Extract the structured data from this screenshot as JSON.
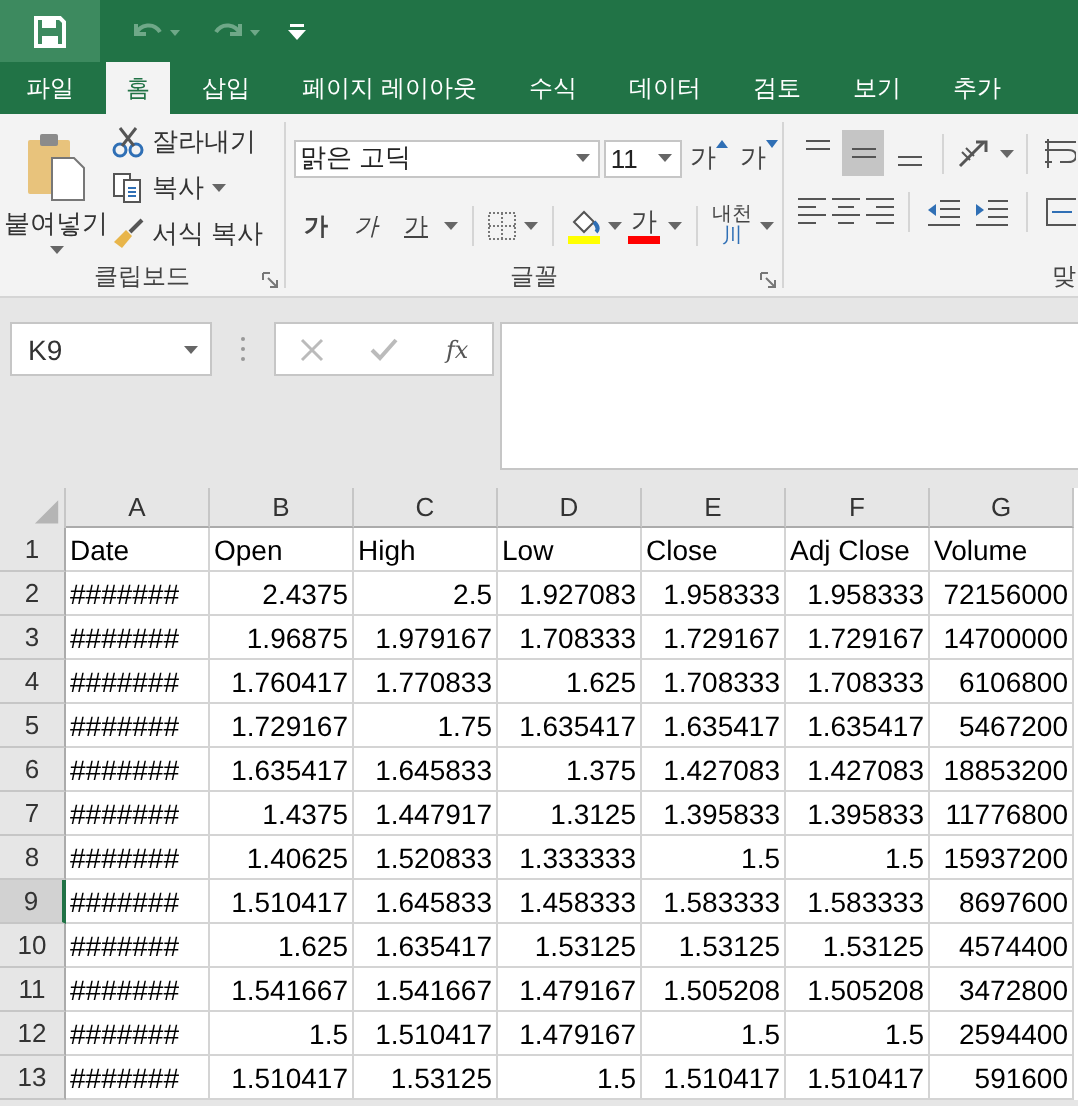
{
  "tabs": [
    {
      "label": "파일",
      "selected": false
    },
    {
      "label": "홈",
      "selected": true
    },
    {
      "label": "삽입",
      "selected": false
    },
    {
      "label": "페이지 레이아웃",
      "selected": false
    },
    {
      "label": "수식",
      "selected": false
    },
    {
      "label": "데이터",
      "selected": false
    },
    {
      "label": "검토",
      "selected": false
    },
    {
      "label": "보기",
      "selected": false
    },
    {
      "label": "추가",
      "selected": false
    }
  ],
  "ribbon": {
    "clipboard": {
      "label": "클립보드",
      "paste": "붙여넣기",
      "cut": "잘라내기",
      "copy": "복사",
      "format_painter": "서식 복사"
    },
    "font": {
      "label": "글꼴",
      "font_name": "맑은 고딕",
      "font_size": "11",
      "grow": "가",
      "shrink": "가",
      "bold": "가",
      "italic": "가",
      "underline": "가",
      "font_color": "가",
      "phonetic": "내천",
      "phonetic_glyph": "川"
    },
    "alignment": {
      "label": "맞",
      "vertical": [
        {
          "kind": "top",
          "selected": false
        },
        {
          "kind": "middle",
          "selected": true
        },
        {
          "kind": "bottom",
          "selected": false
        }
      ],
      "horizontal": [
        {
          "kind": "left",
          "selected": false
        },
        {
          "kind": "center",
          "selected": false
        },
        {
          "kind": "right",
          "selected": false
        }
      ]
    }
  },
  "formula_bar": {
    "name_box": "K9",
    "function": "fx"
  },
  "sheet": {
    "columns": [
      {
        "label": "A"
      },
      {
        "label": "B"
      },
      {
        "label": "C"
      },
      {
        "label": "D"
      },
      {
        "label": "E"
      },
      {
        "label": "F"
      },
      {
        "label": "G"
      }
    ],
    "rows": [
      {
        "header": "1",
        "kind": "labels",
        "selected": false,
        "cells": [
          "Date",
          "Open",
          "High",
          "Low",
          "Close",
          "Adj Close",
          "Volume"
        ]
      },
      {
        "header": "2",
        "kind": "values",
        "selected": false,
        "cells": [
          "#######",
          "2.4375",
          "2.5",
          "1.927083",
          "1.958333",
          "1.958333",
          "72156000"
        ]
      },
      {
        "header": "3",
        "kind": "values",
        "selected": false,
        "cells": [
          "#######",
          "1.96875",
          "1.979167",
          "1.708333",
          "1.729167",
          "1.729167",
          "14700000"
        ]
      },
      {
        "header": "4",
        "kind": "values",
        "selected": false,
        "cells": [
          "#######",
          "1.760417",
          "1.770833",
          "1.625",
          "1.708333",
          "1.708333",
          "6106800"
        ]
      },
      {
        "header": "5",
        "kind": "values",
        "selected": false,
        "cells": [
          "#######",
          "1.729167",
          "1.75",
          "1.635417",
          "1.635417",
          "1.635417",
          "5467200"
        ]
      },
      {
        "header": "6",
        "kind": "values",
        "selected": false,
        "cells": [
          "#######",
          "1.635417",
          "1.645833",
          "1.375",
          "1.427083",
          "1.427083",
          "18853200"
        ]
      },
      {
        "header": "7",
        "kind": "values",
        "selected": false,
        "cells": [
          "#######",
          "1.4375",
          "1.447917",
          "1.3125",
          "1.395833",
          "1.395833",
          "11776800"
        ]
      },
      {
        "header": "8",
        "kind": "values",
        "selected": false,
        "cells": [
          "#######",
          "1.40625",
          "1.520833",
          "1.333333",
          "1.5",
          "1.5",
          "15937200"
        ]
      },
      {
        "header": "9",
        "kind": "values",
        "selected": true,
        "cells": [
          "#######",
          "1.510417",
          "1.645833",
          "1.458333",
          "1.583333",
          "1.583333",
          "8697600"
        ]
      },
      {
        "header": "10",
        "kind": "values",
        "selected": false,
        "cells": [
          "#######",
          "1.625",
          "1.635417",
          "1.53125",
          "1.53125",
          "1.53125",
          "4574400"
        ]
      },
      {
        "header": "11",
        "kind": "values",
        "selected": false,
        "cells": [
          "#######",
          "1.541667",
          "1.541667",
          "1.479167",
          "1.505208",
          "1.505208",
          "3472800"
        ]
      },
      {
        "header": "12",
        "kind": "values",
        "selected": false,
        "cells": [
          "#######",
          "1.5",
          "1.510417",
          "1.479167",
          "1.5",
          "1.5",
          "2594400"
        ]
      },
      {
        "header": "13",
        "kind": "values",
        "selected": false,
        "cells": [
          "#######",
          "1.510417",
          "1.53125",
          "1.5",
          "1.510417",
          "1.510417",
          "591600"
        ]
      }
    ]
  }
}
